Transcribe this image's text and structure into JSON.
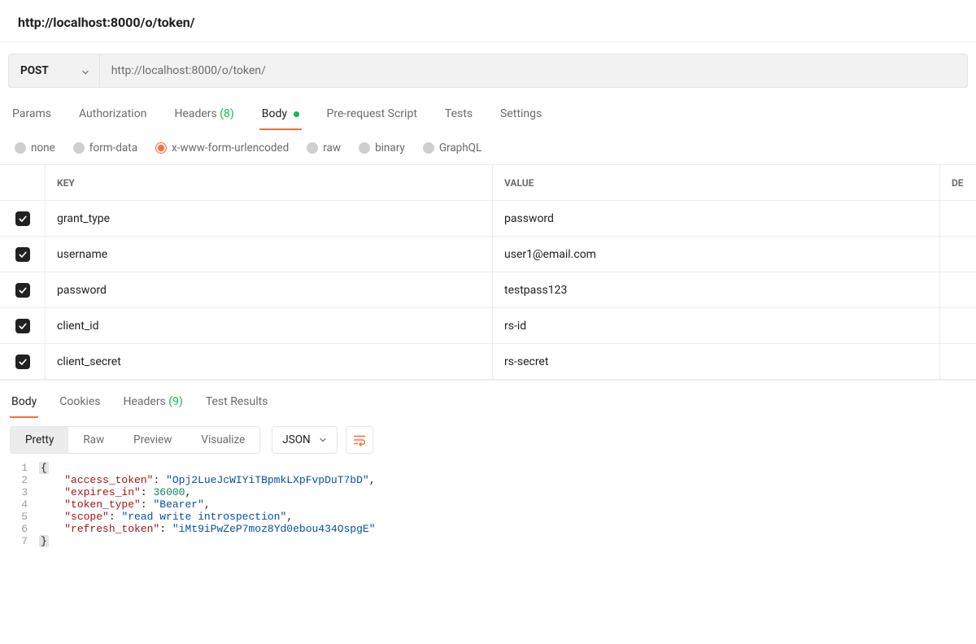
{
  "title": "http://localhost:8000/o/token/",
  "request": {
    "method": "POST",
    "url": "http://localhost:8000/o/token/"
  },
  "reqTabs": {
    "params": "Params",
    "auth": "Authorization",
    "headers_label": "Headers",
    "headers_count": "(8)",
    "body": "Body",
    "preReq": "Pre-request Script",
    "tests": "Tests",
    "settings": "Settings"
  },
  "bodyTypes": {
    "none": "none",
    "formData": "form-data",
    "urlencoded": "x-www-form-urlencoded",
    "raw": "raw",
    "binary": "binary",
    "graphql": "GraphQL"
  },
  "kv": {
    "header_key": "KEY",
    "header_value": "VALUE",
    "header_desc": "DE",
    "rows": [
      {
        "enabled": true,
        "key": "grant_type",
        "value": "password"
      },
      {
        "enabled": true,
        "key": "username",
        "value": "user1@email.com"
      },
      {
        "enabled": true,
        "key": "password",
        "value": "testpass123"
      },
      {
        "enabled": true,
        "key": "client_id",
        "value": "rs-id"
      },
      {
        "enabled": true,
        "key": "client_secret",
        "value": "rs-secret"
      }
    ]
  },
  "respTabs": {
    "body": "Body",
    "cookies": "Cookies",
    "headers_label": "Headers",
    "headers_count": "(9)",
    "testResults": "Test Results"
  },
  "viewBar": {
    "pretty": "Pretty",
    "raw": "Raw",
    "preview": "Preview",
    "visualize": "Visualize",
    "format": "JSON"
  },
  "responseJson": {
    "access_token": "Opj2LueJcWIYiTBpmkLXpFvpDuT7bD",
    "expires_in": 36000,
    "token_type": "Bearer",
    "scope": "read write introspection",
    "refresh_token": "iMt9iPwZeP7moz8Yd0ebou434OspgE"
  }
}
